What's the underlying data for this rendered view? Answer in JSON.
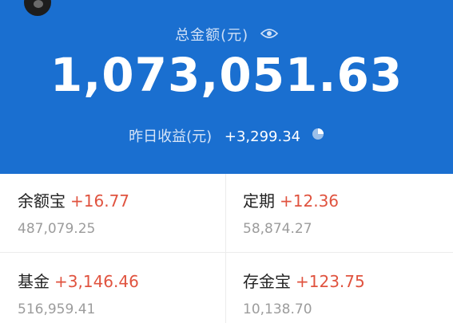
{
  "header": {
    "total_label": "总金额(元)",
    "total_amount": "1,073,051.63",
    "yesterday_label": "昨日收益(元)",
    "yesterday_value": "+3,299.34"
  },
  "cards": [
    {
      "title": "余额宝",
      "change": "+16.77",
      "balance": "487,079.25"
    },
    {
      "title": "定期",
      "change": "+12.36",
      "balance": "58,874.27"
    },
    {
      "title": "基金",
      "change": "+3,146.46",
      "balance": "516,959.41"
    },
    {
      "title": "存金宝",
      "change": "+123.75",
      "balance": "10,138.70"
    }
  ],
  "colors": {
    "header_bg": "#1a6fd0",
    "positive_change": "#e0533f",
    "balance_text": "#9c9c9c"
  },
  "icons": [
    "eye-icon",
    "pie-chart-icon"
  ]
}
